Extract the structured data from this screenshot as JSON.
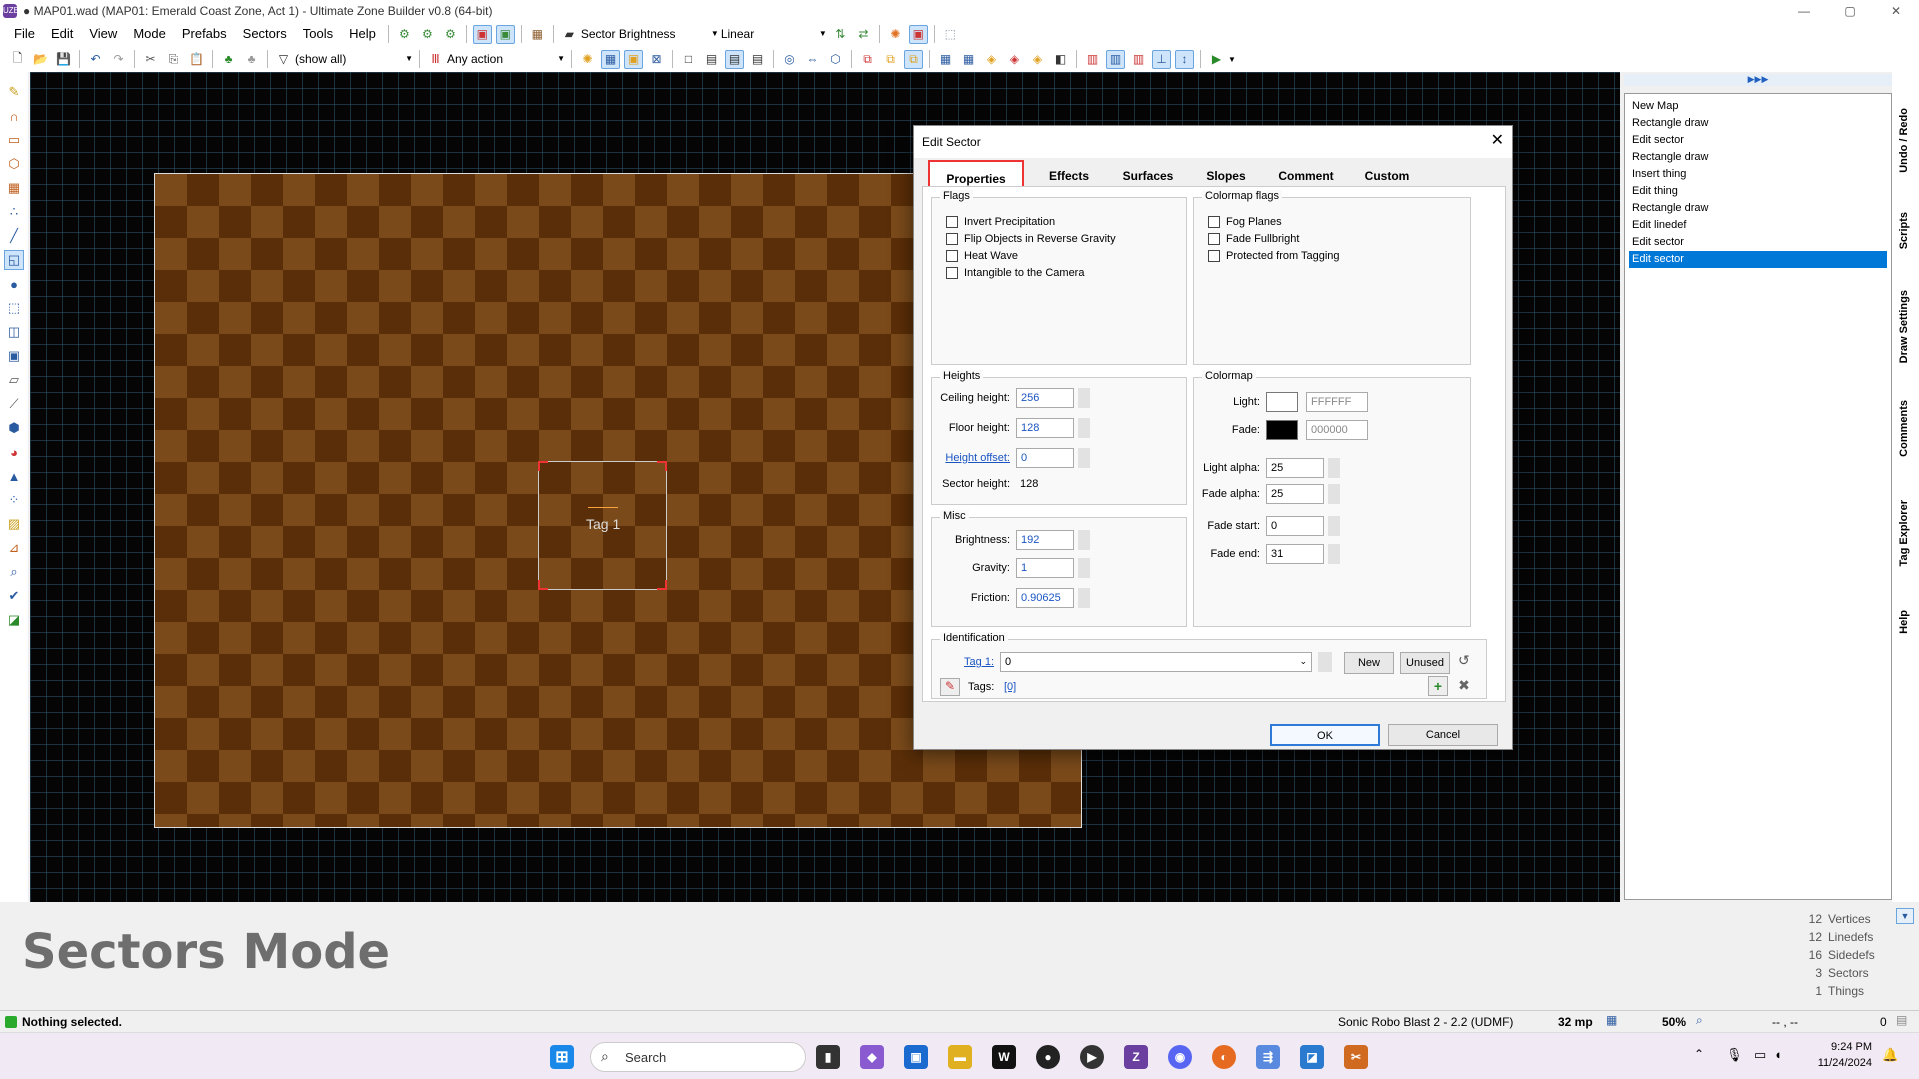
{
  "window": {
    "title": "● MAP01.wad (MAP01: Emerald Coast Zone, Act 1) - Ultimate Zone Builder v0.8 (64-bit)",
    "app_icon": "UZB",
    "controls": {
      "minimize": "—",
      "maximize": "▢",
      "close": "✕"
    }
  },
  "menu": [
    "File",
    "Edit",
    "View",
    "Mode",
    "Prefabs",
    "Sectors",
    "Tools",
    "Help"
  ],
  "toolbar1": {
    "view_mode": "Sector Brightness",
    "interpolation": "Linear"
  },
  "toolbar2": {
    "filter": "(show all)",
    "action": "Any action"
  },
  "map": {
    "tag_label": "Tag 1"
  },
  "dialog": {
    "title": "Edit Sector",
    "close": "✕",
    "tabs": [
      "Properties",
      "Effects",
      "Surfaces",
      "Slopes",
      "Comment",
      "Custom"
    ],
    "flags": {
      "title": "Flags",
      "items": [
        "Invert Precipitation",
        "Flip Objects in Reverse Gravity",
        "Heat Wave",
        "Intangible to the Camera"
      ]
    },
    "colormap_flags": {
      "title": "Colormap flags",
      "items": [
        "Fog Planes",
        "Fade Fullbright",
        "Protected from Tagging"
      ]
    },
    "heights": {
      "title": "Heights",
      "ceiling_label": "Ceiling height:",
      "ceiling": "256",
      "floor_label": "Floor height:",
      "floor": "128",
      "offset_label": "Height offset:",
      "offset": "0",
      "sector_label": "Sector height:",
      "sector": "128"
    },
    "colormap": {
      "title": "Colormap",
      "light_label": "Light:",
      "light": "FFFFFF",
      "light_color": "#ffffff",
      "fade_label": "Fade:",
      "fade": "000000",
      "fade_color": "#000000",
      "light_alpha_label": "Light alpha:",
      "light_alpha": "25",
      "fade_alpha_label": "Fade alpha:",
      "fade_alpha": "25",
      "fade_start_label": "Fade start:",
      "fade_start": "0",
      "fade_end_label": "Fade end:",
      "fade_end": "31"
    },
    "misc": {
      "title": "Misc",
      "brightness_label": "Brightness:",
      "brightness": "192",
      "gravity_label": "Gravity:",
      "gravity": "1",
      "friction_label": "Friction:",
      "friction": "0.90625"
    },
    "identification": {
      "title": "Identification",
      "tag_label": "Tag 1:",
      "tag_value": "0",
      "new_btn": "New",
      "unused_btn": "Unused",
      "tags_label": "Tags:",
      "tags_value": "[0]"
    },
    "ok": "OK",
    "cancel": "Cancel"
  },
  "undo_panel": {
    "header": "▶▶▶",
    "items": [
      "New Map",
      "Rectangle draw",
      "Edit sector",
      "Rectangle draw",
      "Insert thing",
      "Edit thing",
      "Rectangle draw",
      "Edit linedef",
      "Edit sector",
      "Edit sector"
    ],
    "selected_index": 9
  },
  "side_tabs": [
    "Undo / Redo",
    "Scripts",
    "Draw Settings",
    "Comments",
    "Tag Explorer",
    "Help"
  ],
  "mode_label": "Sectors Mode",
  "stats": [
    {
      "n": "12",
      "label": "Vertices"
    },
    {
      "n": "12",
      "label": "Linedefs"
    },
    {
      "n": "16",
      "label": "Sidedefs"
    },
    {
      "n": "3",
      "label": "Sectors"
    },
    {
      "n": "1",
      "label": "Things"
    }
  ],
  "status": {
    "message": "Nothing selected.",
    "game": "Sonic Robo Blast 2 - 2.2 (UDMF)",
    "grid": "32 mp",
    "zoom": "50%",
    "coords": "-- , --",
    "count": "0"
  },
  "taskbar": {
    "search": "Search",
    "time": "9:24 PM",
    "date": "11/24/2024"
  }
}
